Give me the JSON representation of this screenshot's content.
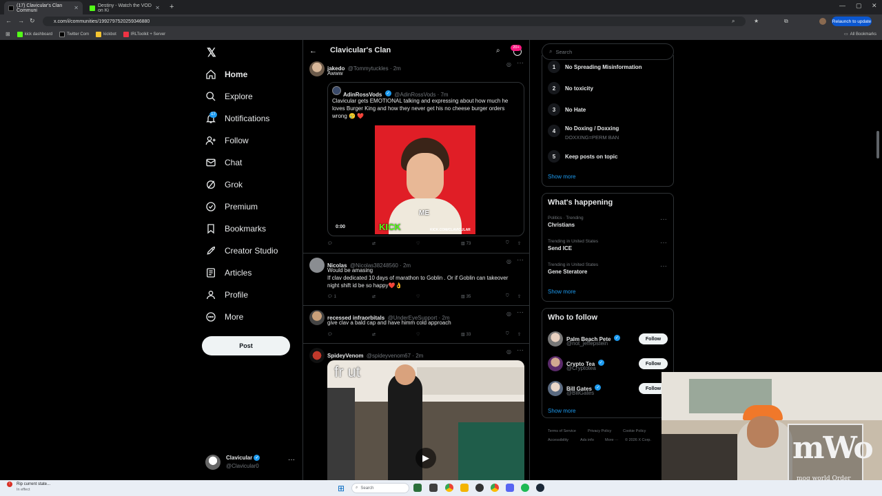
{
  "browser": {
    "tabs": [
      {
        "label": "(17) Clavicular's Clan Communi"
      },
      {
        "label": "Destiny - Watch the VOD on Ki"
      }
    ],
    "url": "x.com/i/communities/1992797520259346880",
    "bookmarks": [
      "kick dashboard",
      "Twitter Com",
      "kickbot",
      "IRLToolkit + Server"
    ],
    "all_bookmarks": "All Bookmarks",
    "relaunch": "Relaunch to update"
  },
  "nav": {
    "items": [
      {
        "label": "Home",
        "icon": "home-icon"
      },
      {
        "label": "Explore",
        "icon": "search-icon"
      },
      {
        "label": "Notifications",
        "icon": "bell-icon"
      },
      {
        "label": "Follow",
        "icon": "follow-icon"
      },
      {
        "label": "Chat",
        "icon": "mail-icon"
      },
      {
        "label": "Grok",
        "icon": "grok-icon"
      },
      {
        "label": "Premium",
        "icon": "premium-icon"
      },
      {
        "label": "Bookmarks",
        "icon": "bookmark-icon"
      },
      {
        "label": "Creator Studio",
        "icon": "rocket-icon"
      },
      {
        "label": "Articles",
        "icon": "article-icon"
      },
      {
        "label": "Profile",
        "icon": "person-icon"
      },
      {
        "label": "More",
        "icon": "more-icon"
      }
    ],
    "notif_count": "17",
    "post": "Post",
    "account_name": "Clavicular",
    "account_handle": "@Clavicular0"
  },
  "header": {
    "title": "Clavicular's Clan",
    "badge": "20+"
  },
  "posts": [
    {
      "name": "jakedo",
      "handle": "@Tommytuckles · 2m",
      "text": "Awww",
      "quote": {
        "name": "AdinRossVods",
        "handle": "@AdinRossVods · 7m",
        "text": "Clavicular gets EMOTIONAL talking and expressing about how much he loves Burger King and how they never get his no cheese burger orders wrong 🥲 ❤️",
        "time": "0:00",
        "me": "ME",
        "kick": "KICK",
        "kickurl": "KICK.COM/CLAVICULAR"
      },
      "views": "73"
    },
    {
      "name": "Nicolas",
      "handle": "@Nicolas38248560 · 2m",
      "lines": [
        "Would be amasing",
        "If clav dedicated 10 days of marathon to Goblin . Or if Goblin can takeover",
        "night shift id be so happy❤️👌"
      ],
      "replies": "1",
      "views": "35"
    },
    {
      "name": "recessed infraorbitals",
      "handle": "@UnderEyeSupport · 2m",
      "text": "give clav a bald cap and have himm cold approach",
      "views": "33"
    },
    {
      "name": "SpideyVenom",
      "handle": "@spideyvenom67 · 2m",
      "overlay": "fr ut"
    }
  ],
  "search": {
    "placeholder": "Search"
  },
  "rules": [
    {
      "n": "1",
      "label": "No Spreading Misinformation"
    },
    {
      "n": "2",
      "label": "No toxicity"
    },
    {
      "n": "3",
      "label": "No Hate"
    },
    {
      "n": "4",
      "label": "No Doxing / Doxxing",
      "sub": "DOXXING=PERM BAN"
    },
    {
      "n": "5",
      "label": "Keep posts on topic"
    }
  ],
  "show_more": "Show more",
  "happening": {
    "title": "What's happening",
    "items": [
      {
        "context": "Politics · Trending",
        "topic": "Christians"
      },
      {
        "context": "Trending in United States",
        "topic": "Send ICE"
      },
      {
        "context": "Trending in United States",
        "topic": "Gene Steratore"
      }
    ]
  },
  "who_to_follow": {
    "title": "Who to follow",
    "follow": "Follow",
    "users": [
      {
        "name": "Palm Beach Pete",
        "handle": "@not_jeffepstein"
      },
      {
        "name": "Crypto Tea",
        "handle": "@Cryptotea"
      },
      {
        "name": "Bill Gates",
        "handle": "@BillGates"
      }
    ]
  },
  "footer": [
    "Terms of Service",
    "Privacy Policy",
    "Cookie Policy",
    "Accessibility",
    "Ads info",
    "More ···",
    "© 2026 X Corp."
  ],
  "webcam": {
    "logo": "mWo",
    "sub": "mog world Order"
  },
  "taskbar": {
    "notice_title": "Rip current state...",
    "notice_sub": "In effect",
    "search": "Search"
  },
  "colors": {
    "accent": "#1d9bf0",
    "like": "#f91880",
    "kick": "#53fc18"
  }
}
